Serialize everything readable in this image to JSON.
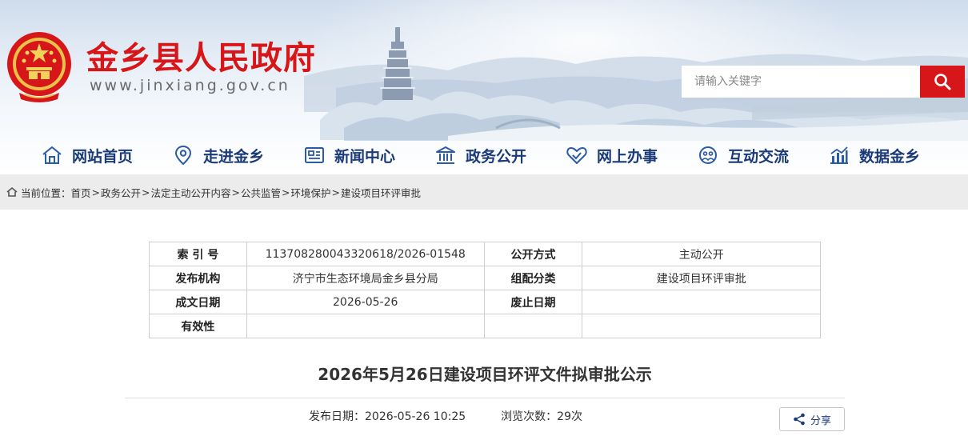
{
  "header": {
    "site_title": "金乡县人民政府",
    "site_url": "www.jinxiang.gov.cn",
    "brand_color": "#d7161a",
    "nav_color": "#1b3a78"
  },
  "search": {
    "placeholder": "请输入关键字",
    "button_icon": "search-icon"
  },
  "nav": {
    "items": [
      {
        "label": "网站首页",
        "icon": "home-icon"
      },
      {
        "label": "走进金乡",
        "icon": "location-pin-icon"
      },
      {
        "label": "新闻中心",
        "icon": "newspaper-icon"
      },
      {
        "label": "政务公开",
        "icon": "government-building-icon"
      },
      {
        "label": "网上办事",
        "icon": "handshake-heart-icon"
      },
      {
        "label": "互动交流",
        "icon": "chat-people-icon"
      },
      {
        "label": "数据金乡",
        "icon": "bar-chart-icon"
      }
    ]
  },
  "breadcrumb": {
    "prefix": "当前位置：",
    "items": [
      "首页",
      "政务公开",
      "法定主动公开内容",
      "公共监管",
      "环境保护",
      "建设项目环评审批"
    ],
    "separator": ">"
  },
  "info_table": {
    "rows": [
      {
        "k1": "索 引 号",
        "v1": "11370828004332061​8/2026-01548",
        "k2": "公开方式",
        "v2": "主动公开"
      },
      {
        "k1": "发布机构",
        "v1": "济宁市生态环境局金乡县分局",
        "k2": "组配分类",
        "v2": "建设项目环评审批"
      },
      {
        "k1": "成文日期",
        "v1": "2026-05-26",
        "k2": "废止日期",
        "v2": ""
      },
      {
        "k1": "有效性",
        "v1": "",
        "k2": "",
        "v2": ""
      }
    ]
  },
  "article": {
    "title": "2026年5月26日建设项目环评文件拟审批公示",
    "publish_label": "发布日期：",
    "publish_date": "2026-05-26 10:25",
    "views_label": "浏览次数：",
    "views": "29次",
    "share_label": "分享"
  }
}
